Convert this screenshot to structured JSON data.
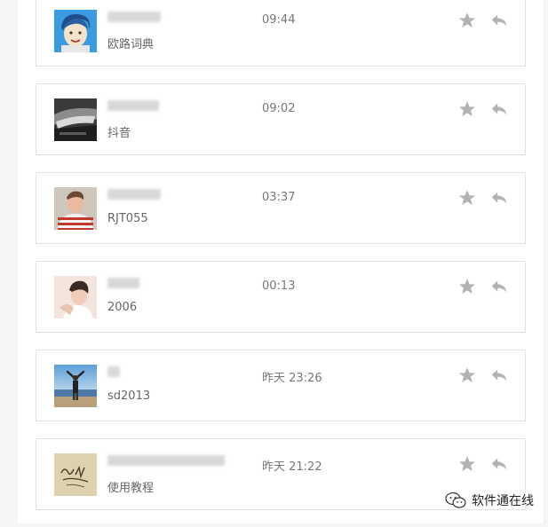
{
  "messages": [
    {
      "subtitle": "欧路词典",
      "time": "09:44",
      "avatar": "anime-avatar-icon"
    },
    {
      "subtitle": "抖音",
      "time": "09:02",
      "avatar": "car-headlight-avatar-icon"
    },
    {
      "subtitle": "RJT055",
      "time": "03:37",
      "avatar": "person-striped-shirt-avatar-icon"
    },
    {
      "subtitle": "2006",
      "time": "00:13",
      "avatar": "person-portrait-avatar-icon"
    },
    {
      "subtitle": "sd2013",
      "time": "昨天 23:26",
      "avatar": "person-beach-avatar-icon"
    },
    {
      "subtitle": "使用教程",
      "time": "昨天 21:22",
      "avatar": "handwriting-card-avatar-icon"
    }
  ],
  "actions": {
    "star_icon": "star-icon",
    "reply_icon": "reply-icon"
  },
  "colors": {
    "icon_gray": "#b3b3b3",
    "card_border": "#e3e3e3",
    "text_gray": "#666666"
  },
  "watermark": {
    "text": "软件通在线",
    "icon": "wechat-logo-icon"
  }
}
